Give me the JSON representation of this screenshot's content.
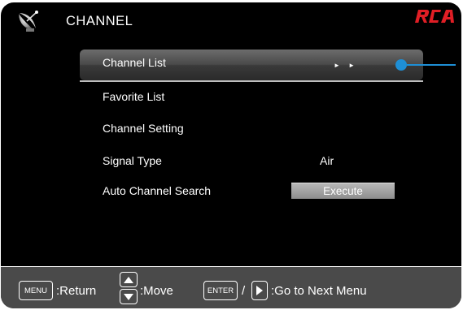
{
  "header": {
    "title": "CHANNEL",
    "brand": "RCA",
    "icon": "satellite-dish-icon"
  },
  "menu": {
    "items": [
      {
        "label": "Channel List",
        "selected": true,
        "indicator": "► ►"
      },
      {
        "label": "Favorite List"
      },
      {
        "label": "Channel Setting"
      },
      {
        "label": "Signal Type",
        "value": "Air"
      },
      {
        "label": "Auto Channel Search",
        "button": "Execute"
      }
    ]
  },
  "footer": {
    "menu_key": "MENU",
    "return_label": ":Return",
    "move_label": ":Move",
    "enter_key": "ENTER",
    "slash": "/",
    "next_label": ":Go to Next Menu"
  },
  "colors": {
    "background": "#000000",
    "footer": "#4a4a4a",
    "brand_red": "#e01e25",
    "pointer_blue": "#1e8fd6"
  }
}
